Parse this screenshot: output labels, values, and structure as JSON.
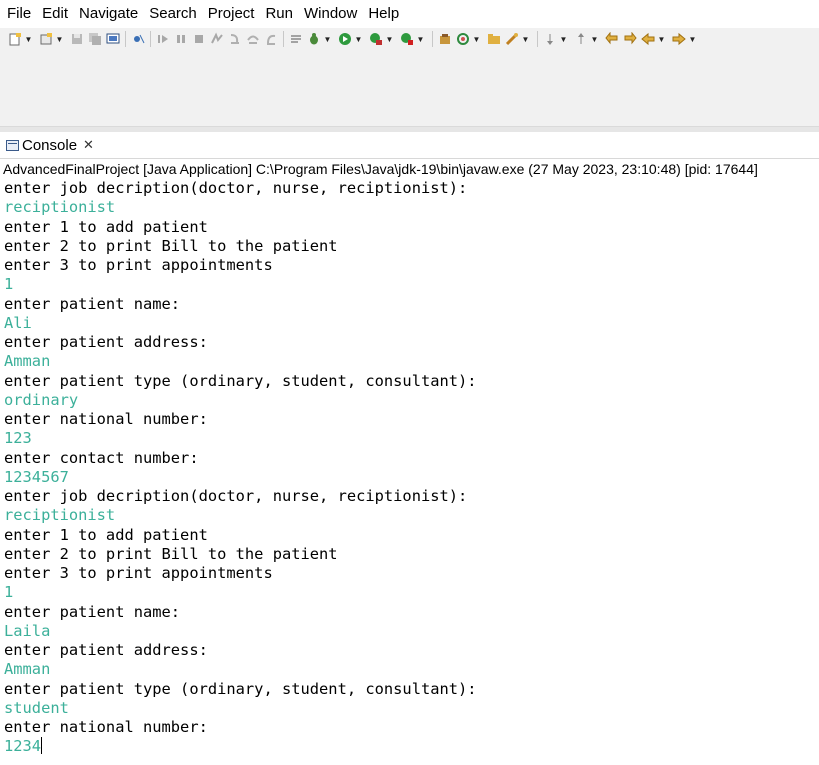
{
  "menubar": {
    "items": [
      "File",
      "Edit",
      "Navigate",
      "Search",
      "Project",
      "Run",
      "Window",
      "Help"
    ]
  },
  "toolbar": {
    "icons": [
      "new-icon",
      "save-icon",
      "save-all-icon",
      "build-icon",
      "skip-breakpoints-icon",
      "resume-icon",
      "suspend-icon",
      "terminate-icon",
      "disconnect-icon",
      "step-into-icon",
      "step-over-icon",
      "step-return-icon",
      "use-step-filters-icon",
      "debug-icon",
      "run-icon",
      "coverage-icon",
      "external-tools-icon",
      "new-java-package-icon",
      "new-java-class-icon",
      "open-type-icon",
      "search-icon",
      "next-annotation-icon",
      "previous-annotation-icon",
      "last-edit-location-icon",
      "back-icon",
      "forward-icon"
    ]
  },
  "console": {
    "tab_label": "Console",
    "status": "AdvancedFinalProject [Java Application] C:\\Program Files\\Java\\jdk-19\\bin\\javaw.exe  (27 May 2023, 23:10:48) [pid: 17644]",
    "lines": [
      {
        "text": "enter job decription(doctor, nurse, reciptionist):",
        "input": false
      },
      {
        "text": "reciptionist",
        "input": true
      },
      {
        "text": "enter 1 to add patient",
        "input": false
      },
      {
        "text": "enter 2 to print Bill to the patient",
        "input": false
      },
      {
        "text": "enter 3 to print appointments",
        "input": false
      },
      {
        "text": "1",
        "input": true
      },
      {
        "text": "enter patient name:",
        "input": false
      },
      {
        "text": "Ali",
        "input": true
      },
      {
        "text": "enter patient address:",
        "input": false
      },
      {
        "text": "Amman",
        "input": true
      },
      {
        "text": "enter patient type (ordinary, student, consultant):",
        "input": false
      },
      {
        "text": "ordinary",
        "input": true
      },
      {
        "text": "enter national number:",
        "input": false
      },
      {
        "text": "123",
        "input": true
      },
      {
        "text": "enter contact number:",
        "input": false
      },
      {
        "text": "1234567",
        "input": true
      },
      {
        "text": "enter job decription(doctor, nurse, reciptionist):",
        "input": false
      },
      {
        "text": "reciptionist",
        "input": true
      },
      {
        "text": "enter 1 to add patient",
        "input": false
      },
      {
        "text": "enter 2 to print Bill to the patient",
        "input": false
      },
      {
        "text": "enter 3 to print appointments",
        "input": false
      },
      {
        "text": "1",
        "input": true
      },
      {
        "text": "enter patient name:",
        "input": false
      },
      {
        "text": "Laila",
        "input": true
      },
      {
        "text": "enter patient address:",
        "input": false
      },
      {
        "text": "Amman",
        "input": true
      },
      {
        "text": "enter patient type (ordinary, student, consultant):",
        "input": false
      },
      {
        "text": "student",
        "input": true
      },
      {
        "text": "enter national number:",
        "input": false
      },
      {
        "text": "1234",
        "input": true
      }
    ]
  },
  "colors": {
    "input_text": "#3cb09a",
    "output_text": "#000000"
  }
}
